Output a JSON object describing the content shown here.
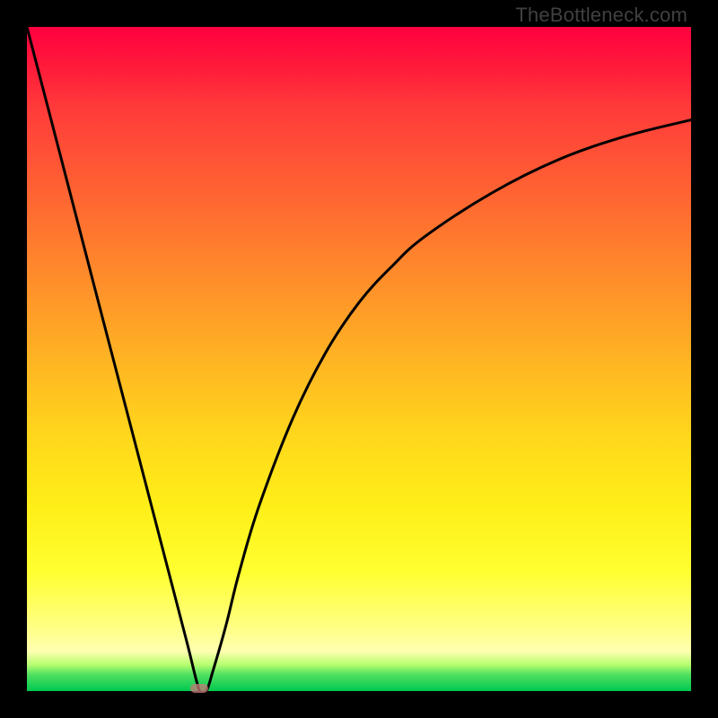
{
  "watermark": "TheBottleneck.com",
  "colors": {
    "frame": "#000000",
    "curve": "#000000",
    "marker": "#c97a7a",
    "gradient_top": "#ff0040",
    "gradient_bottom": "#00c850"
  },
  "chart_data": {
    "type": "line",
    "title": "",
    "xlabel": "",
    "ylabel": "",
    "xlim": [
      0,
      100
    ],
    "ylim": [
      0,
      100
    ],
    "grid": false,
    "legend": false,
    "series": [
      {
        "name": "bottleneck-curve",
        "x": [
          0,
          5,
          10,
          15,
          20,
          24,
          26,
          27,
          28,
          30,
          32,
          35,
          40,
          45,
          50,
          55,
          60,
          70,
          80,
          90,
          100
        ],
        "y": [
          100,
          80.8,
          61.5,
          42.3,
          23.1,
          7.7,
          0,
          0,
          3,
          10,
          18,
          28,
          41,
          51,
          58.5,
          64,
          68.5,
          75,
          80,
          83.5,
          86
        ]
      }
    ],
    "annotations": [
      {
        "type": "marker",
        "shape": "pill",
        "x": 26,
        "y": 0,
        "color": "#c97a7a"
      }
    ]
  }
}
